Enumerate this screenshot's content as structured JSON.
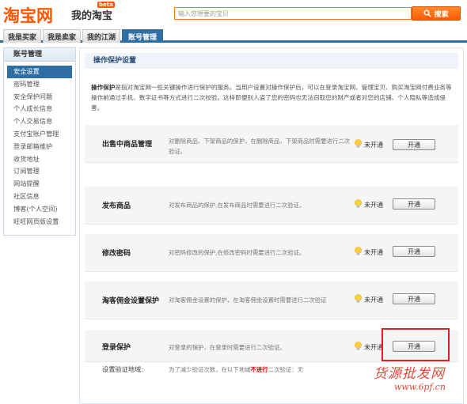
{
  "header": {
    "logo": "淘宝网",
    "logo_sub": "我的淘宝",
    "beta": "beta",
    "search_placeholder": "输入您想要的宝贝",
    "search_button": "搜索"
  },
  "nav": {
    "tabs": [
      "我是买家",
      "我是卖家",
      "我的江湖",
      "账号管理"
    ],
    "active_tab": "账号管理"
  },
  "sidebar": {
    "title": "账号管理",
    "items": [
      "安全设置",
      "密码管理",
      "安全保护问题",
      "个人成长信息",
      "个人交易信息",
      "支付宝账户管理",
      "登录邮箱维护",
      "收货地址",
      "订阅管理",
      "网站提醒",
      "社区信息",
      "博客(个人空间)",
      "旺旺网页版设置"
    ],
    "active_item": "安全设置"
  },
  "main": {
    "title": "操作保护设置",
    "intro_bold": "操作保护",
    "intro_text": "是指对淘宝网一些关键操作进行保护的服务。当用户设置对操作保护后，可以在登录淘宝网、管理宝贝、购买淘宝网付费业务等操作前通过手机、数字证书等方式进行二次校验。这样即便别人盗了您的密码也无法窃取您的财产或者对您的店铺、个人隐私等造成侵害。",
    "rows": [
      {
        "name": "出售中商品管理",
        "desc": "对删除商品、下架商品的保护，在删除商品、下架商品时需要进行二次验证。",
        "status": "未开通",
        "button": "开通"
      },
      {
        "name": "发布商品",
        "desc": "对发布商品的保护,在发布商品时需要进行二次验证。",
        "status": "未开通",
        "button": "开通"
      },
      {
        "name": "修改密码",
        "desc": "对密码修改的保护,在修改密码时需要进行二次验证。",
        "status": "未开通",
        "button": "开通"
      },
      {
        "name": "淘客佣金设置保护",
        "desc": "对淘客佣金设置的保护，在淘客佣金设置时需要进行二次验证",
        "status": "未开通",
        "button": "开通"
      },
      {
        "name": "登录保护",
        "desc": "对登录的保护，在登录时需要进行二次验证。",
        "status": "未开通",
        "button": "开通"
      }
    ],
    "verify": {
      "label": "设置验证地域:",
      "text_before": "为了减少验证次数，在以下地域",
      "text_red": "不进行",
      "text_after": "二次验证：无"
    }
  },
  "watermark": {
    "line1": "货源批发网",
    "line2": "www.6pf.cn"
  },
  "colors": {
    "brand": "#ff5500",
    "nav_active": "#2f6ea3",
    "highlight": "#e02020"
  }
}
